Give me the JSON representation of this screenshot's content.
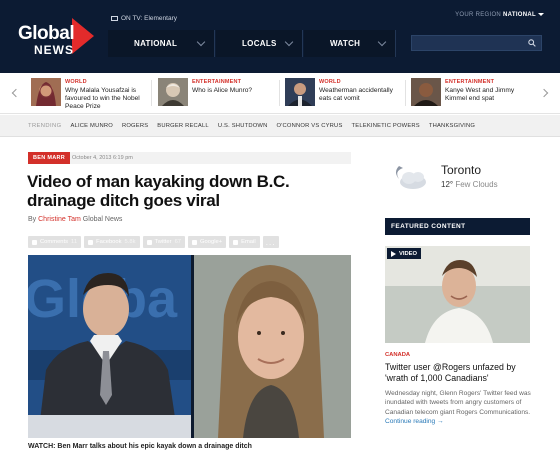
{
  "header": {
    "logo_word": "Global",
    "logo_sub": "NEWS",
    "on_tv": "ON TV: Elementary",
    "region_label": "YOUR REGION",
    "region_value": "NATIONAL",
    "nav": [
      "NATIONAL",
      "LOCALS",
      "WATCH"
    ],
    "search_placeholder": ""
  },
  "headlines": [
    {
      "category": "WORLD",
      "title": "Why Malala Yousafzai is favoured to win the Nobel Peace Prize"
    },
    {
      "category": "ENTERTAINMENT",
      "title": "Who is Alice Munro?"
    },
    {
      "category": "WORLD",
      "title": "Weatherman accidentally eats cat vomit"
    },
    {
      "category": "ENTERTAINMENT",
      "title": "Kanye West and Jimmy Kimmel end spat"
    }
  ],
  "trending": {
    "label": "TRENDING",
    "items": [
      "ALICE MUNRO",
      "ROGERS",
      "BURGER RECALL",
      "U.S. SHUTDOWN",
      "O'CONNOR VS CYRUS",
      "TELEKINETIC POWERS",
      "THANKSGIVING"
    ]
  },
  "article": {
    "kicker": "BEN MARR",
    "date": "October 4, 2013 6:19 pm",
    "title": "Video of man kayaking down B.C. drainage ditch goes viral",
    "byline_prefix": "By",
    "author": "Christine Tam",
    "outlet": "Global News",
    "share": [
      {
        "label": "Comments",
        "count": "11"
      },
      {
        "label": "Facebook",
        "count": "5.8k"
      },
      {
        "label": "Twitter",
        "count": "67"
      },
      {
        "label": "Google+",
        "count": ""
      },
      {
        "label": "Email",
        "count": ""
      }
    ],
    "share_more": "...",
    "video_caption": "WATCH: Ben Marr talks about his epic kayak down a drainage ditch",
    "studio_wall_text": "Globa"
  },
  "weather": {
    "city": "Toronto",
    "temp": "12°",
    "condition": "Few Clouds"
  },
  "featured": {
    "heading": "FEATURED CONTENT",
    "tag": "VIDEO",
    "category": "CANADA",
    "title": "Twitter user @Rogers unfazed by 'wrath of 1,000 Canadians'",
    "summary": "Wednesday night, Glenn Rogers' Twitter feed was inundated with tweets from angry customers of Canadian telecom giant Rogers Communications.",
    "more": "Continue reading →"
  },
  "colors": {
    "navy": "#0c1b33",
    "accent_red": "#d3302a",
    "link_blue": "#2a7ab8"
  }
}
